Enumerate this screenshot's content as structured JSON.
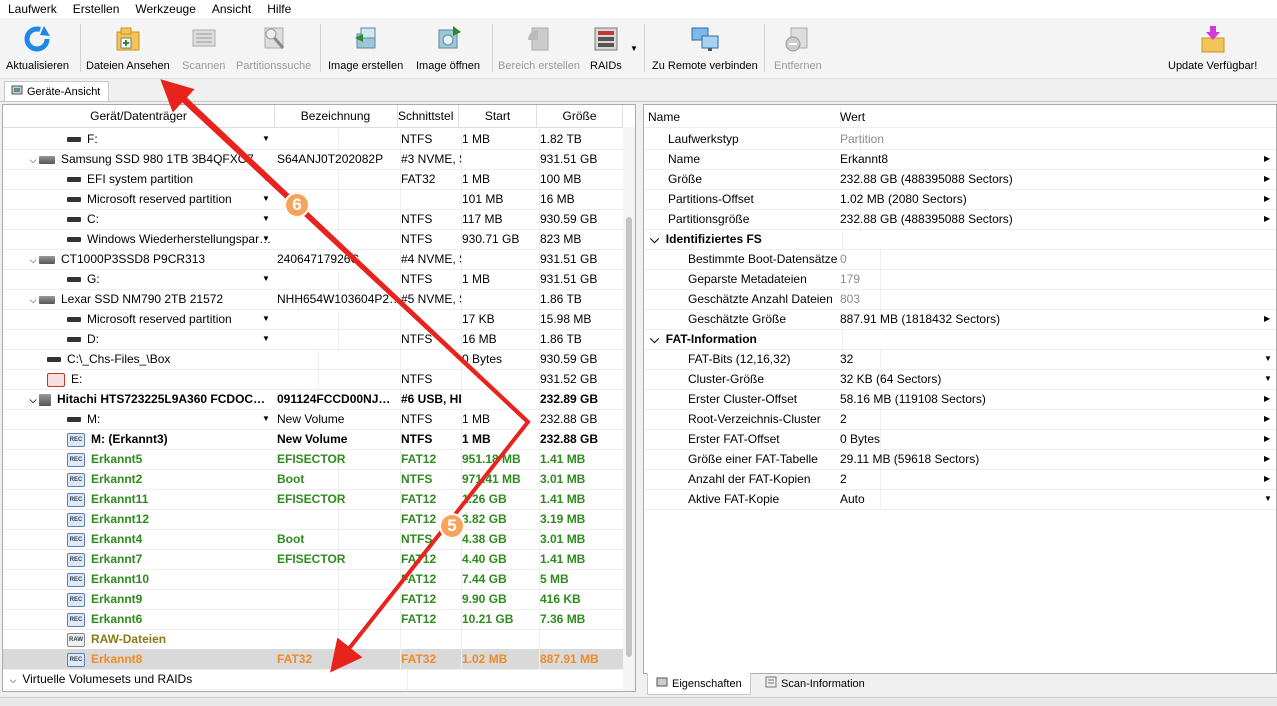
{
  "menu": [
    "Laufwerk",
    "Erstellen",
    "Werkzeuge",
    "Ansicht",
    "Hilfe"
  ],
  "toolbar": {
    "refresh": "Aktualisieren",
    "view_files": "Dateien Ansehen",
    "scan": "Scannen",
    "partition_search": "Partitionssuche",
    "create_image": "Image erstellen",
    "open_image": "Image öffnen",
    "create_region": "Bereich erstellen",
    "raids": "RAIDs",
    "connect_remote": "Zu Remote verbinden",
    "remove": "Entfernen",
    "update": "Update Verfügbar!"
  },
  "device_tab": "Geräte-Ansicht",
  "columns": {
    "device": "Gerät/Datenträger",
    "label": "Bezeichnung",
    "interface": "Schnittstel",
    "start": "Start",
    "size": "Größe"
  },
  "rows": [
    {
      "name": "F:",
      "label": "",
      "interface": "NTFS",
      "start": "1 MB",
      "size": "1.82 TB"
    },
    {
      "name": "Samsung SSD 980 1TB 3B4QFXO7",
      "label": "S64ANJ0T202082P",
      "interface": "#3 NVME, SSD",
      "start": "",
      "size": "931.51 GB"
    },
    {
      "name": "EFI system partition",
      "label": "",
      "interface": "FAT32",
      "start": "1 MB",
      "size": "100 MB"
    },
    {
      "name": "Microsoft reserved partition",
      "label": "",
      "interface": "",
      "start": "101 MB",
      "size": "16 MB"
    },
    {
      "name": "C:",
      "label": "",
      "interface": "NTFS",
      "start": "117 MB",
      "size": "930.59 GB"
    },
    {
      "name": "Windows Wiederherstellungspar…",
      "label": "",
      "interface": "NTFS",
      "start": "930.71 GB",
      "size": "823 MB"
    },
    {
      "name": "CT1000P3SSD8 P9CR313",
      "label": "24064717926C",
      "interface": "#4 NVME, SSD",
      "start": "",
      "size": "931.51 GB"
    },
    {
      "name": "G:",
      "label": "",
      "interface": "NTFS",
      "start": "1 MB",
      "size": "931.51 GB"
    },
    {
      "name": "Lexar SSD NM790 2TB 21572",
      "label": "NHH654W103604P2…",
      "interface": "#5 NVME, SSD",
      "start": "",
      "size": "1.86 TB"
    },
    {
      "name": "Microsoft reserved partition",
      "label": "",
      "interface": "",
      "start": "17 KB",
      "size": "15.98 MB"
    },
    {
      "name": "D:",
      "label": "",
      "interface": "NTFS",
      "start": "16 MB",
      "size": "1.86 TB"
    },
    {
      "name": "C:\\_Chs-Files_\\Box",
      "label": "",
      "interface": "",
      "start": "0 Bytes",
      "size": "930.59 GB"
    },
    {
      "name": "E:",
      "label": "",
      "interface": "NTFS",
      "start": "",
      "size": "931.52 GB"
    },
    {
      "name": "Hitachi HTS723225L9A360 FCDOC…",
      "label": "091124FCCD00NJ…",
      "interface": "#6 USB, HDD",
      "start": "",
      "size": "232.89 GB"
    },
    {
      "name": "M:",
      "label": "New Volume",
      "interface": "NTFS",
      "start": "1 MB",
      "size": "232.88 GB"
    },
    {
      "name": "M: (Erkannt3)",
      "label": "New Volume",
      "interface": "NTFS",
      "start": "1 MB",
      "size": "232.88 GB"
    },
    {
      "name": "Erkannt5",
      "label": "EFISECTOR",
      "interface": "FAT12",
      "start": "951.18 MB",
      "size": "1.41 MB"
    },
    {
      "name": "Erkannt2",
      "label": "Boot",
      "interface": "NTFS",
      "start": "971.41 MB",
      "size": "3.01 MB"
    },
    {
      "name": "Erkannt11",
      "label": "EFISECTOR",
      "interface": "FAT12",
      "start": "1.26 GB",
      "size": "1.41 MB"
    },
    {
      "name": "Erkannt12",
      "label": "",
      "interface": "FAT12",
      "start": "3.82 GB",
      "size": "3.19 MB"
    },
    {
      "name": "Erkannt4",
      "label": "Boot",
      "interface": "NTFS",
      "start": "4.38 GB",
      "size": "3.01 MB"
    },
    {
      "name": "Erkannt7",
      "label": "EFISECTOR",
      "interface": "FAT12",
      "start": "4.40 GB",
      "size": "1.41 MB"
    },
    {
      "name": "Erkannt10",
      "label": "",
      "interface": "FAT12",
      "start": "7.44 GB",
      "size": "5 MB"
    },
    {
      "name": "Erkannt9",
      "label": "",
      "interface": "FAT12",
      "start": "9.90 GB",
      "size": "416 KB"
    },
    {
      "name": "Erkannt6",
      "label": "",
      "interface": "FAT12",
      "start": "10.21 GB",
      "size": "7.36 MB"
    },
    {
      "name": "RAW-Dateien",
      "label": "",
      "interface": "",
      "start": "",
      "size": ""
    },
    {
      "name": "Erkannt8",
      "label": "FAT32",
      "interface": "FAT32",
      "start": "1.02 MB",
      "size": "887.91 MB"
    },
    {
      "name": "Virtuelle Volumesets und RAIDs",
      "label": "",
      "interface": "",
      "start": "",
      "size": ""
    }
  ],
  "props_header": {
    "name": "Name",
    "value": "Wert"
  },
  "props": [
    {
      "name": "Laufwerkstyp",
      "value": "Partition"
    },
    {
      "name": "Name",
      "value": "Erkannt8"
    },
    {
      "name": "Größe",
      "value": "232.88 GB (488395088 Sectors)"
    },
    {
      "name": "Partitions-Offset",
      "value": "1.02 MB (2080 Sectors)"
    },
    {
      "name": "Partitionsgröße",
      "value": "232.88 GB (488395088 Sectors)"
    },
    {
      "name": "Identifiziertes FS",
      "value": ""
    },
    {
      "name": "Bestimmte Boot-Datensätze",
      "value": "0"
    },
    {
      "name": "Geparste Metadateien",
      "value": "179"
    },
    {
      "name": "Geschätzte Anzahl Dateien",
      "value": "803"
    },
    {
      "name": "Geschätzte Größe",
      "value": "887.91 MB (1818432 Sectors)"
    },
    {
      "name": "FAT-Information",
      "value": ""
    },
    {
      "name": "FAT-Bits (12,16,32)",
      "value": "32"
    },
    {
      "name": "Cluster-Größe",
      "value": "32 KB (64 Sectors)"
    },
    {
      "name": "Erster Cluster-Offset",
      "value": "58.16 MB (119108 Sectors)"
    },
    {
      "name": "Root-Verzeichnis-Cluster",
      "value": "2"
    },
    {
      "name": "Erster FAT-Offset",
      "value": "0 Bytes"
    },
    {
      "name": "Größe einer FAT-Tabelle",
      "value": "29.11 MB (59618 Sectors)"
    },
    {
      "name": "Anzahl der FAT-Kopien",
      "value": "2"
    },
    {
      "name": "Aktive FAT-Kopie",
      "value": "Auto"
    }
  ],
  "bottom_tabs": {
    "properties": "Eigenschaften",
    "scan_info": "Scan-Information"
  },
  "callouts": {
    "six": "6",
    "five": "5"
  },
  "colors": {
    "detected": "#2e8b1e",
    "raw": "#8b7a1a",
    "selected": "#f08a24",
    "arrow": "#e8221c",
    "badge": "#f7a35c"
  }
}
